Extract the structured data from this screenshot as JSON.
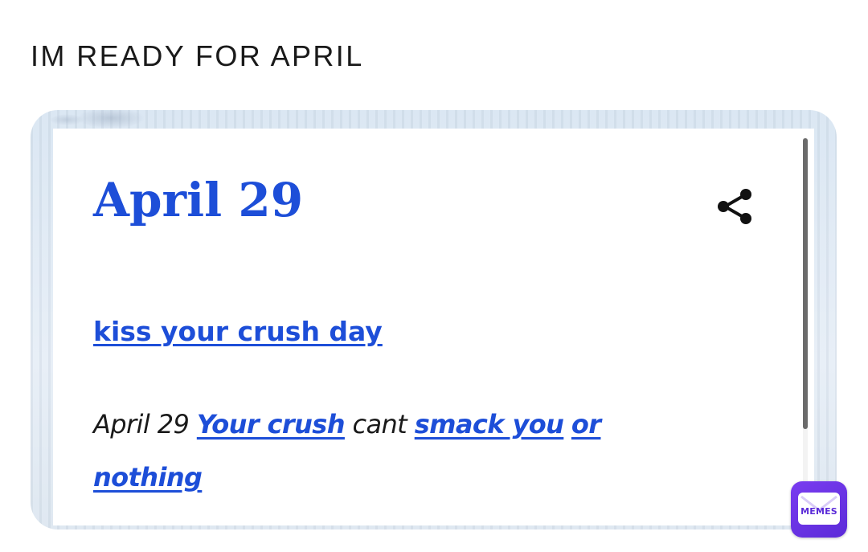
{
  "caption": "IM READY FOR APRIL",
  "entry": {
    "date": "April 29",
    "share_icon": "share-icon",
    "word": "kiss your crush day",
    "definition": {
      "t1": "April 29 ",
      "l1": "Your crush",
      "t2": " cant ",
      "l2": "smack you",
      "t3": " ",
      "l3": "or",
      "t4": " ",
      "l4": "nothing"
    }
  },
  "watermark": {
    "label": "MEMES",
    "icon": "envelope-icon"
  },
  "colors": {
    "link": "#1d4ed8",
    "text": "#1a1a1a",
    "badge": "#6a34e6"
  }
}
